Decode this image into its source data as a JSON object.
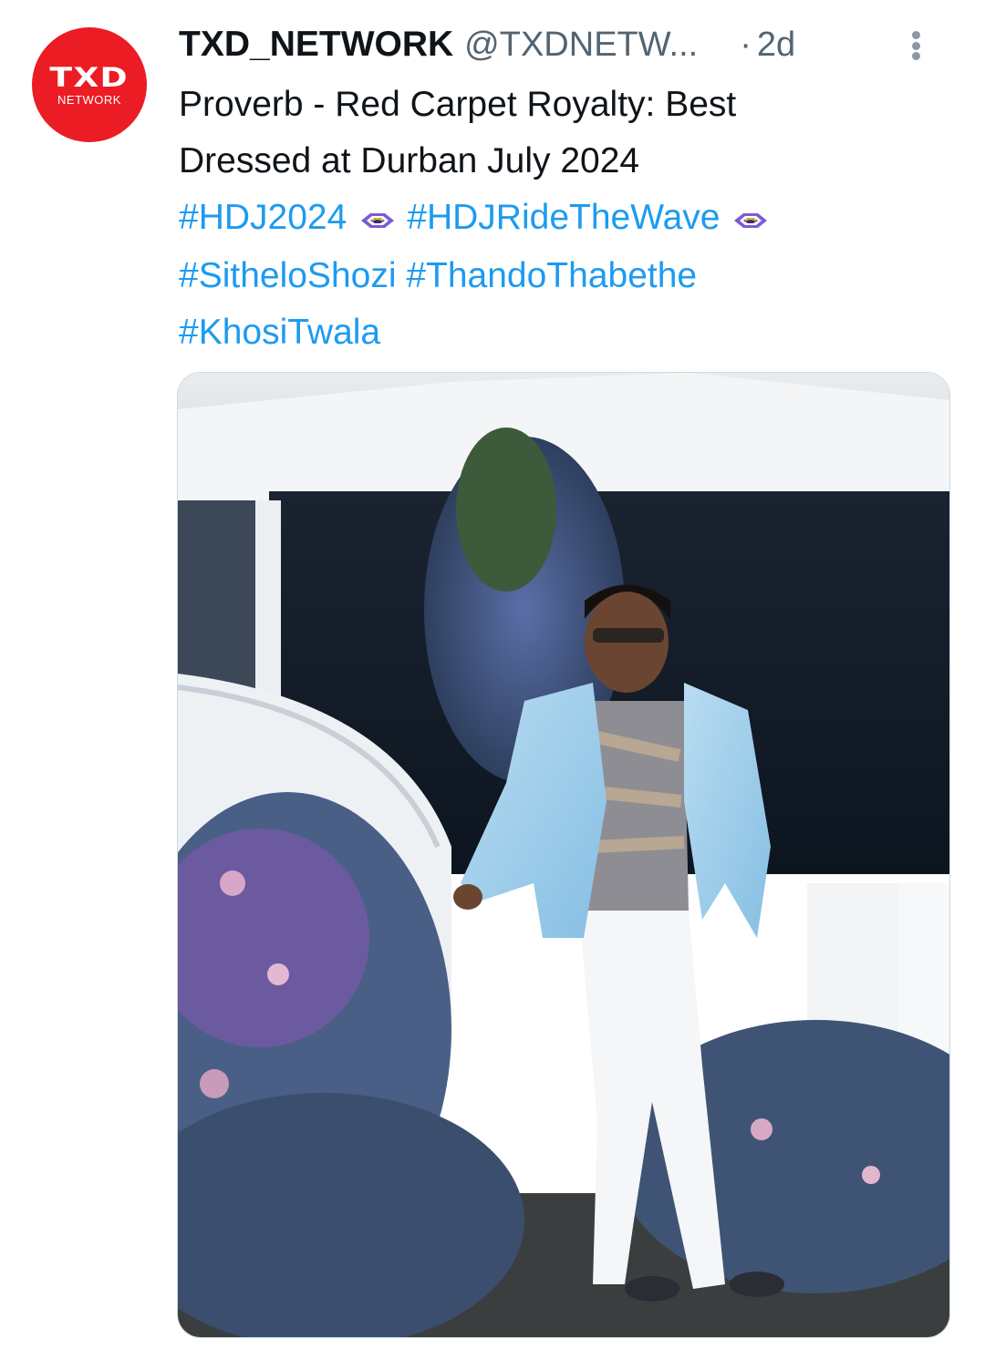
{
  "tweet": {
    "author_name": "TXD_NETWORK",
    "handle": "@TXDNETW...",
    "dot": "·",
    "time_ago": "2d",
    "avatar": {
      "logo_main": "TXD",
      "logo_sub": "NETWORK",
      "background": "#ec1c24"
    },
    "text_line_1": "Proverb - Red Carpet Royalty: Best",
    "text_line_2": "Dressed at Durban July 2024",
    "hashtags": [
      "#HDJ2024",
      "#HDJRideTheWave",
      "#SitheloShozi",
      "#ThandoThabethe",
      "#KhosiTwala"
    ],
    "hashtag_emoji": "wave-emblem-icon",
    "more_icon": "more-vertical-icon",
    "media": {
      "kind": "photo",
      "description_icon": "photo-image"
    }
  },
  "colors": {
    "text": "#0f1419",
    "secondary": "#536471",
    "link": "#1d9bf0",
    "brand": "#ec1c24"
  }
}
